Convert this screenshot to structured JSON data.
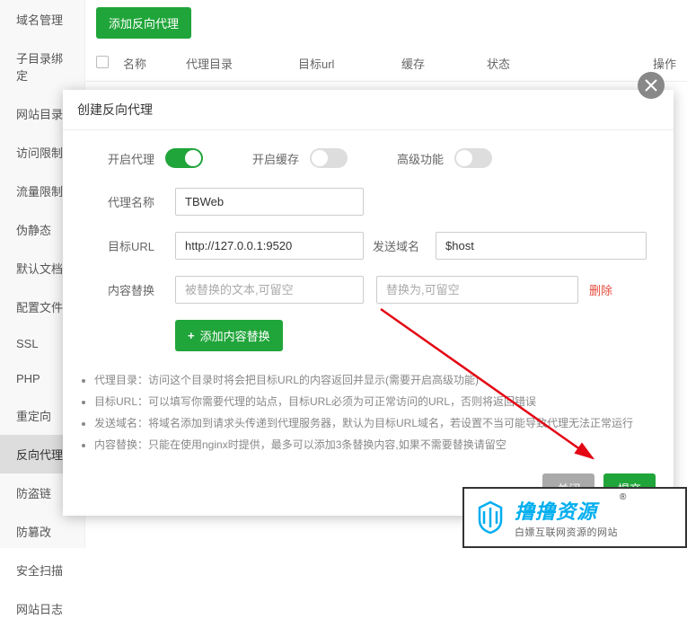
{
  "sidebar": {
    "items": [
      {
        "label": "域名管理"
      },
      {
        "label": "子目录绑定"
      },
      {
        "label": "网站目录"
      },
      {
        "label": "访问限制"
      },
      {
        "label": "流量限制"
      },
      {
        "label": "伪静态"
      },
      {
        "label": "默认文档"
      },
      {
        "label": "配置文件"
      },
      {
        "label": "SSL"
      },
      {
        "label": "PHP"
      },
      {
        "label": "重定向"
      },
      {
        "label": "反向代理"
      },
      {
        "label": "防盗链"
      },
      {
        "label": "防篡改"
      },
      {
        "label": "安全扫描"
      },
      {
        "label": "网站日志"
      }
    ],
    "active_index": 11
  },
  "main": {
    "add_btn": "添加反向代理",
    "columns": {
      "name": "名称",
      "dir": "代理目录",
      "url": "目标url",
      "cache": "缓存",
      "status": "状态",
      "ops": "操作"
    }
  },
  "modal": {
    "title": "创建反向代理",
    "toggles": {
      "proxy": {
        "label": "开启代理",
        "on": true
      },
      "cache": {
        "label": "开启缓存",
        "on": false
      },
      "advanced": {
        "label": "高级功能",
        "on": false
      }
    },
    "fields": {
      "name": {
        "label": "代理名称",
        "value": "TBWeb"
      },
      "url": {
        "label": "目标URL",
        "value": "http://127.0.0.1:9520"
      },
      "domain": {
        "label": "发送域名",
        "value": "$host"
      },
      "replace": {
        "label": "内容替换",
        "ph1": "被替换的文本,可留空",
        "ph2": "替换为,可留空",
        "delete": "删除"
      }
    },
    "add_replace_btn": "添加内容替换",
    "help": [
      "代理目录：访问这个目录时将会把目标URL的内容返回并显示(需要开启高级功能)",
      "目标URL：可以填写你需要代理的站点，目标URL必须为可正常访问的URL，否则将返回错误",
      "发送域名：将域名添加到请求头传递到代理服务器，默认为目标URL域名，若设置不当可能导致代理无法正常运行",
      "内容替换：只能在使用nginx时提供，最多可以添加3条替换内容,如果不需要替换请留空"
    ],
    "footer": {
      "close": "关闭",
      "submit": "提交"
    }
  },
  "watermark": {
    "main": "撸撸资源",
    "sub": "白嫖互联网资源的网站"
  }
}
